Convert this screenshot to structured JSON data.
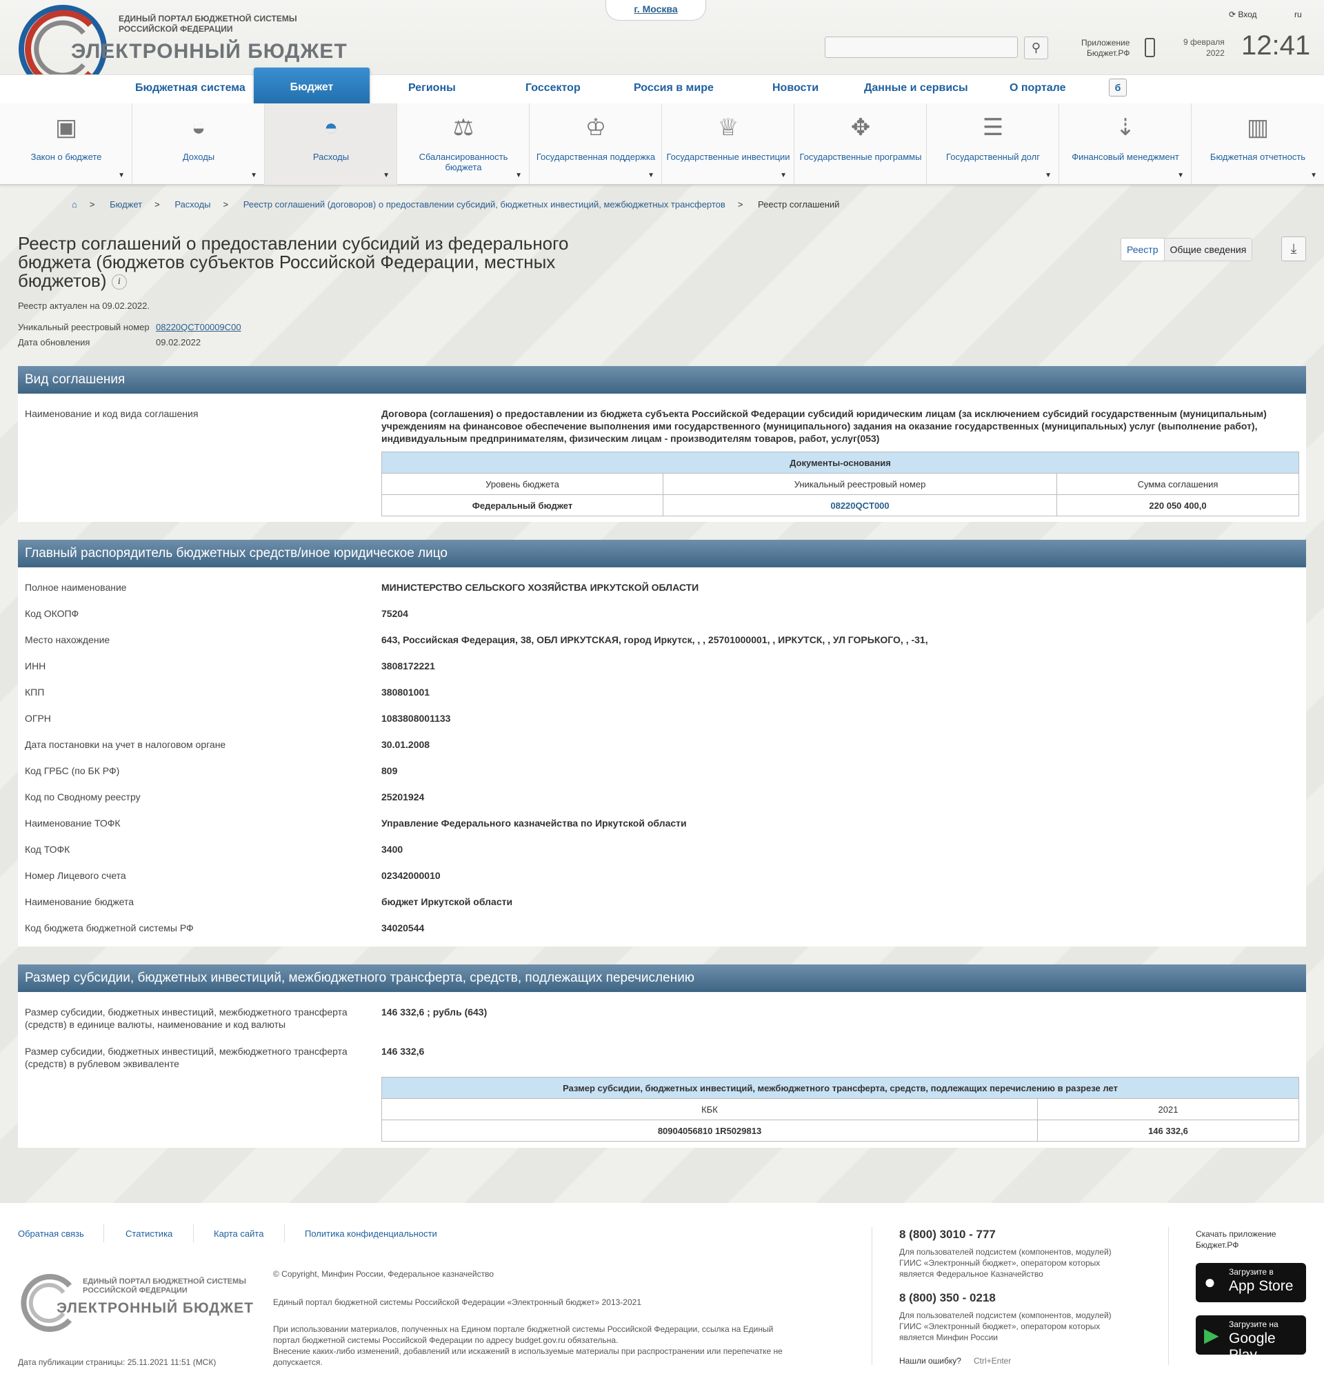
{
  "header": {
    "logo_line1": "ЕДИНЫЙ ПОРТАЛ БЮДЖЕТНОЙ СИСТЕМЫ",
    "logo_line2": "РОССИЙСКОЙ ФЕДЕРАЦИИ",
    "logo_main": "ЭЛЕКТРОННЫЙ БЮДЖЕТ",
    "city": "г. Москва",
    "login": "Вход",
    "lang": "ru",
    "app_line1": "Приложение",
    "app_line2": "Бюджет.РФ",
    "date_line1": "9 февраля",
    "date_line2": "2022",
    "time": "12:41"
  },
  "nav": {
    "items": [
      "Бюджетная система",
      "Бюджет",
      "Регионы",
      "Госсектор",
      "Россия в мире",
      "Новости",
      "Данные и сервисы",
      "О портале"
    ],
    "active": "Бюджет"
  },
  "icons": {
    "items": [
      "Закон о бюджете",
      "Доходы",
      "Расходы",
      "Сбалансированность бюджета",
      "Государственная поддержка",
      "Государственные инвестиции",
      "Государственные программы",
      "Государственный долг",
      "Финансовый менеджмент",
      "Бюджетная отчетность"
    ]
  },
  "breadcrumb": [
    "Бюджет",
    "Расходы",
    "Реестр соглашений (договоров) о предоставлении субсидий, бюджетных инвестиций, межбюджетных трансфертов",
    "Реестр соглашений"
  ],
  "page": {
    "title": "Реестр соглашений о предоставлении субсидий из федерального бюджета (бюджетов субъектов Российской Федерации, местных бюджетов)",
    "actual": "Реестр актуален на 09.02.2022.",
    "reg_label": "Уникальный реестровый номер",
    "reg_value": "08220QCT00009C00",
    "upd_label": "Дата обновления",
    "upd_value": "09.02.2022",
    "tab1": "Реестр",
    "tab2": "Общие сведения"
  },
  "sec1": {
    "title": "Вид соглашения",
    "label": "Наименование и код вида соглашения",
    "value": "Договора (соглашения) о предоставлении из бюджета субъекта Российской Федерации субсидий юридическим лицам (за исключением субсидий государственным (муниципальным) учреждениям на финансовое обеспечение выполнения ими государственного (муниципального) задания на оказание государственных (муниципальных) услуг (выполнение работ), индивидуальным предпринимателям, физическим лицам - производителям товаров, работ, услуг(053)",
    "table_title": "Документы-основания",
    "cols": [
      "Уровень бюджета",
      "Уникальный реестровый номер",
      "Сумма соглашения"
    ],
    "row": [
      "Федеральный бюджет",
      "08220QCT000",
      "220 050 400,0"
    ]
  },
  "sec2": {
    "title": "Главный распорядитель бюджетных средств/иное юридическое лицо",
    "rows": [
      {
        "label": "Полное наименование",
        "value": "МИНИСТЕРСТВО СЕЛЬСКОГО ХОЗЯЙСТВА ИРКУТСКОЙ ОБЛАСТИ"
      },
      {
        "label": "Код ОКОПФ",
        "value": "75204"
      },
      {
        "label": "Место нахождение",
        "value": "643, Российская Федерация, 38, ОБЛ ИРКУТСКАЯ, город Иркутск, , , 25701000001, , ИРКУТСК, , УЛ ГОРЬКОГО, , -31,"
      },
      {
        "label": "ИНН",
        "value": "3808172221"
      },
      {
        "label": "КПП",
        "value": "380801001"
      },
      {
        "label": "ОГРН",
        "value": "1083808001133"
      },
      {
        "label": "Дата постановки на учет в налоговом органе",
        "value": "30.01.2008"
      },
      {
        "label": "Код ГРБС (по БК РФ)",
        "value": "809"
      },
      {
        "label": "Код по Сводному реестру",
        "value": "25201924"
      },
      {
        "label": "Наименование ТОФК",
        "value": "Управление Федерального казначейства по Иркутской области"
      },
      {
        "label": "Код ТОФК",
        "value": "3400"
      },
      {
        "label": "Номер Лицевого счета",
        "value": "02342000010"
      },
      {
        "label": "Наименование бюджета",
        "value": "бюджет Иркутской области"
      },
      {
        "label": "Код бюджета бюджетной системы РФ",
        "value": "34020544"
      }
    ]
  },
  "sec3": {
    "title": "Размер субсидии, бюджетных инвестиций, межбюджетного трансферта, средств, подлежащих перечислению",
    "label1": "Размер субсидии, бюджетных инвестиций, межбюджетного трансферта (средств) в единице валюты, наименование и код валюты",
    "value1": "146 332,6 ; рубль (643)",
    "label2": "Размер субсидии, бюджетных инвестиций, межбюджетного трансферта (средств) в рублевом эквиваленте",
    "value2": "146 332,6",
    "table_title": "Размер субсидии, бюджетных инвестиций, межбюджетного трансферта, средств, подлежащих перечислению в разрезе лет",
    "cols": [
      "КБК",
      "2021"
    ],
    "row": [
      "80904056810 1R5029813",
      "146 332,6"
    ]
  },
  "footer": {
    "links": [
      "Обратная связь",
      "Статистика",
      "Карта сайта",
      "Политика конфиденциальности"
    ],
    "copyright": "© Copyright, Минфин России, Федеральное казначейство",
    "portal": "Единый портал бюджетной системы Российской Федерации «Электронный бюджет» 2013-2021",
    "notice1": "При использовании материалов, полученных на Едином портале бюджетной системы Российской Федерации, ссылка на Единый",
    "notice2": "портал бюджетной системы Российской Федерации по адресу budget.gov.ru обязательна.",
    "notice3": "Внесение каких-либо изменений, добавлений или искажений в используемые материалы при распространении или перепечатке не",
    "notice4": "допускается.",
    "pub_date": "Дата публикации страницы: 25.11.2021 11:51 (МСК)",
    "phone1": "8 (800) 3010 - 777",
    "phone1_desc1": "Для пользователей подсистем (компонентов, модулей)",
    "phone1_desc2": "ГИИС «Электронный бюджет», оператором которых",
    "phone1_desc3": "является Федеральное Казначейство",
    "phone2": "8 (800) 350 - 0218",
    "phone2_desc1": "Для пользователей подсистем (компонентов, модулей)",
    "phone2_desc2": "ГИИС «Электронный бюджет», оператором которых",
    "phone2_desc3": "является Минфин России",
    "error_label": "Нашли ошибку?",
    "error_keys": "Ctrl+Enter",
    "download1": "Скачать приложение",
    "download2": "Бюджет.РФ",
    "appstore_small": "Загрузите в",
    "appstore_big": "App Store",
    "gplay_small": "Загрузите на",
    "gplay_big": "Google Play",
    "logo_line1": "ЕДИНЫЙ ПОРТАЛ БЮДЖЕТНОЙ СИСТЕМЫ",
    "logo_line2": "РОССИЙСКОЙ ФЕДЕРАЦИИ",
    "logo_main": "ЭЛЕКТРОННЫЙ БЮДЖЕТ"
  }
}
